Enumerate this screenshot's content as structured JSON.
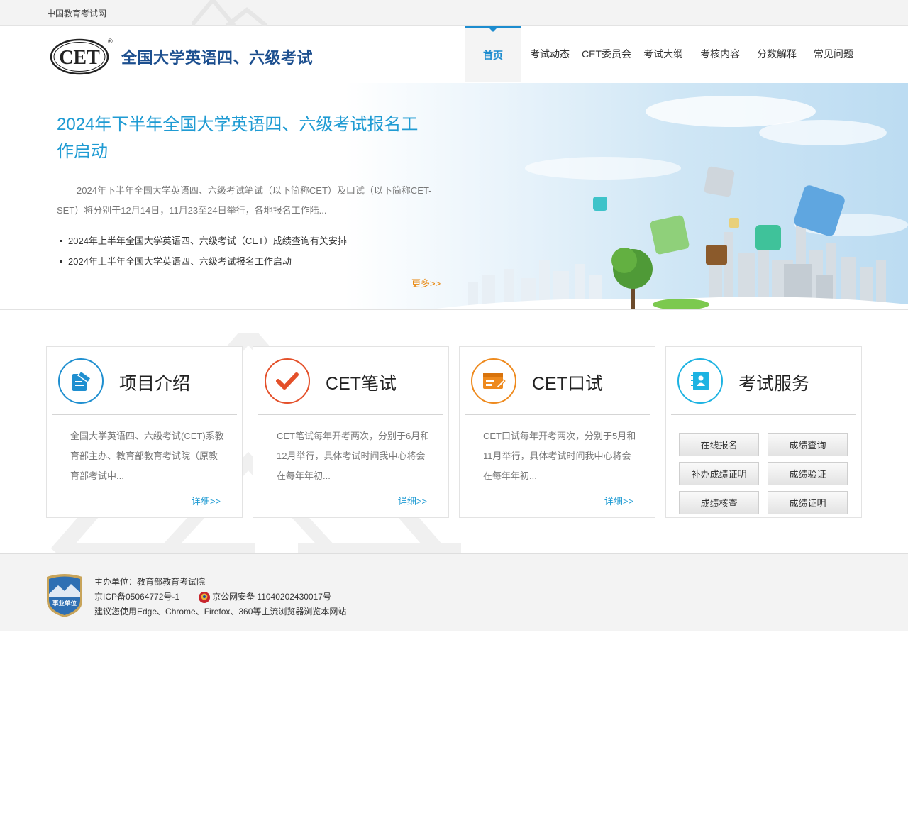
{
  "topbar": {
    "site_name": "中国教育考试网"
  },
  "header": {
    "logo_text": "CET",
    "logo_reg": "®",
    "title": "全国大学英语四、六级考试",
    "nav": [
      {
        "label": "首页",
        "active": true
      },
      {
        "label": "考试动态"
      },
      {
        "label": "CET委员会"
      },
      {
        "label": "考试大纲"
      },
      {
        "label": "考核内容"
      },
      {
        "label": "分数解释"
      },
      {
        "label": "常见问题"
      }
    ]
  },
  "banner": {
    "headline": "2024年下半年全国大学英语四、六级考试报名工作启动",
    "summary": "2024年下半年全国大学英语四、六级考试笔试（以下简称CET）及口试（以下简称CET-SET）将分别于12月14日，11月23至24日举行，各地报名工作陆...",
    "news": [
      "2024年上半年全国大学英语四、六级考试（CET）成绩查询有关安排",
      "2024年上半年全国大学英语四、六级考试报名工作启动"
    ],
    "more": "更多>>"
  },
  "cards": [
    {
      "title": "项目介绍",
      "text": "全国大学英语四、六级考试(CET)系教育部主办、教育部教育考试院（原教育部考试中...",
      "more": "详细>>",
      "color": "#1f8fd0"
    },
    {
      "title": "CET笔试",
      "text": "CET笔试每年开考两次，分别于6月和12月举行，具体考试时间我中心将会在每年年初...",
      "more": "详细>>",
      "color": "#e4502a"
    },
    {
      "title": "CET口试",
      "text": "CET口试每年开考两次，分别于5月和11月举行，具体考试时间我中心将会在每年年初...",
      "more": "详细>>",
      "color": "#ee8a1e"
    },
    {
      "title": "考试服务",
      "color": "#1db3e2",
      "buttons": [
        "在线报名",
        "成绩查询",
        "补办成绩证明",
        "成绩验证",
        "成绩核查",
        "成绩证明"
      ]
    }
  ],
  "footer": {
    "badge_text": "事业单位",
    "sponsor": "主办单位：教育部教育考试院",
    "icp": "京ICP备05064772号-1",
    "police": "京公网安备 11040202430017号",
    "browser_tip": "建议您使用Edge、Chrome、Firefox、360等主流浏览器浏览本网站"
  }
}
